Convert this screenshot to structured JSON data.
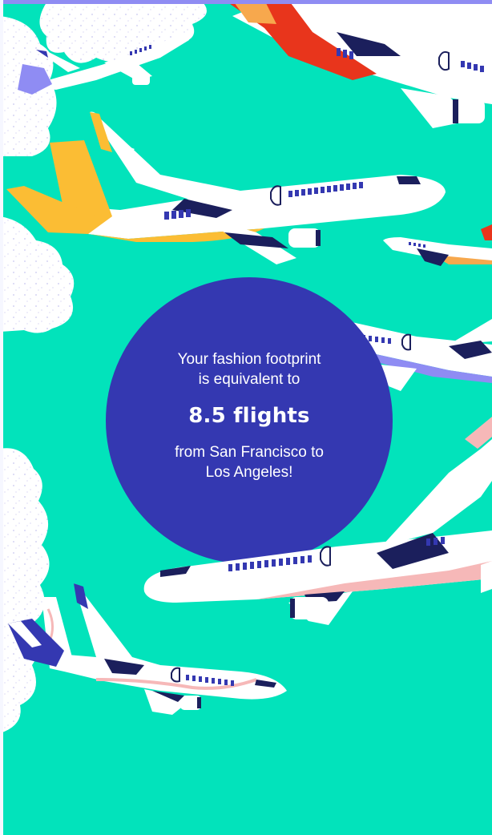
{
  "footprint": {
    "lead_line1": "Your fashion footprint",
    "lead_line2": "is equivalent to",
    "headline": "8.5 flights",
    "route_line1": "from San Francisco to",
    "route_line2": "Los Angeles!"
  },
  "colors": {
    "background": "#02e3bb",
    "circle": "#3438b1",
    "plane_body": "#ffffff",
    "plane_navy": "#1b1f5c",
    "window_blue": "#3438b1",
    "plane_red": "#e8351c",
    "plane_yellow": "#fbbd34",
    "plane_lavender": "#8f8cf3",
    "plane_pink": "#f6b8b8",
    "plane_orange": "#f7a84d"
  },
  "illustration": {
    "planes": [
      "plane-red-tail",
      "plane-lavender-tail",
      "plane-yellow-tail",
      "plane-small-orange",
      "plane-lavender-right",
      "plane-pink-large",
      "plane-pink-lower"
    ],
    "clouds": [
      "cloud-top",
      "cloud-left-upper",
      "cloud-left-middle",
      "cloud-left-lower"
    ]
  }
}
